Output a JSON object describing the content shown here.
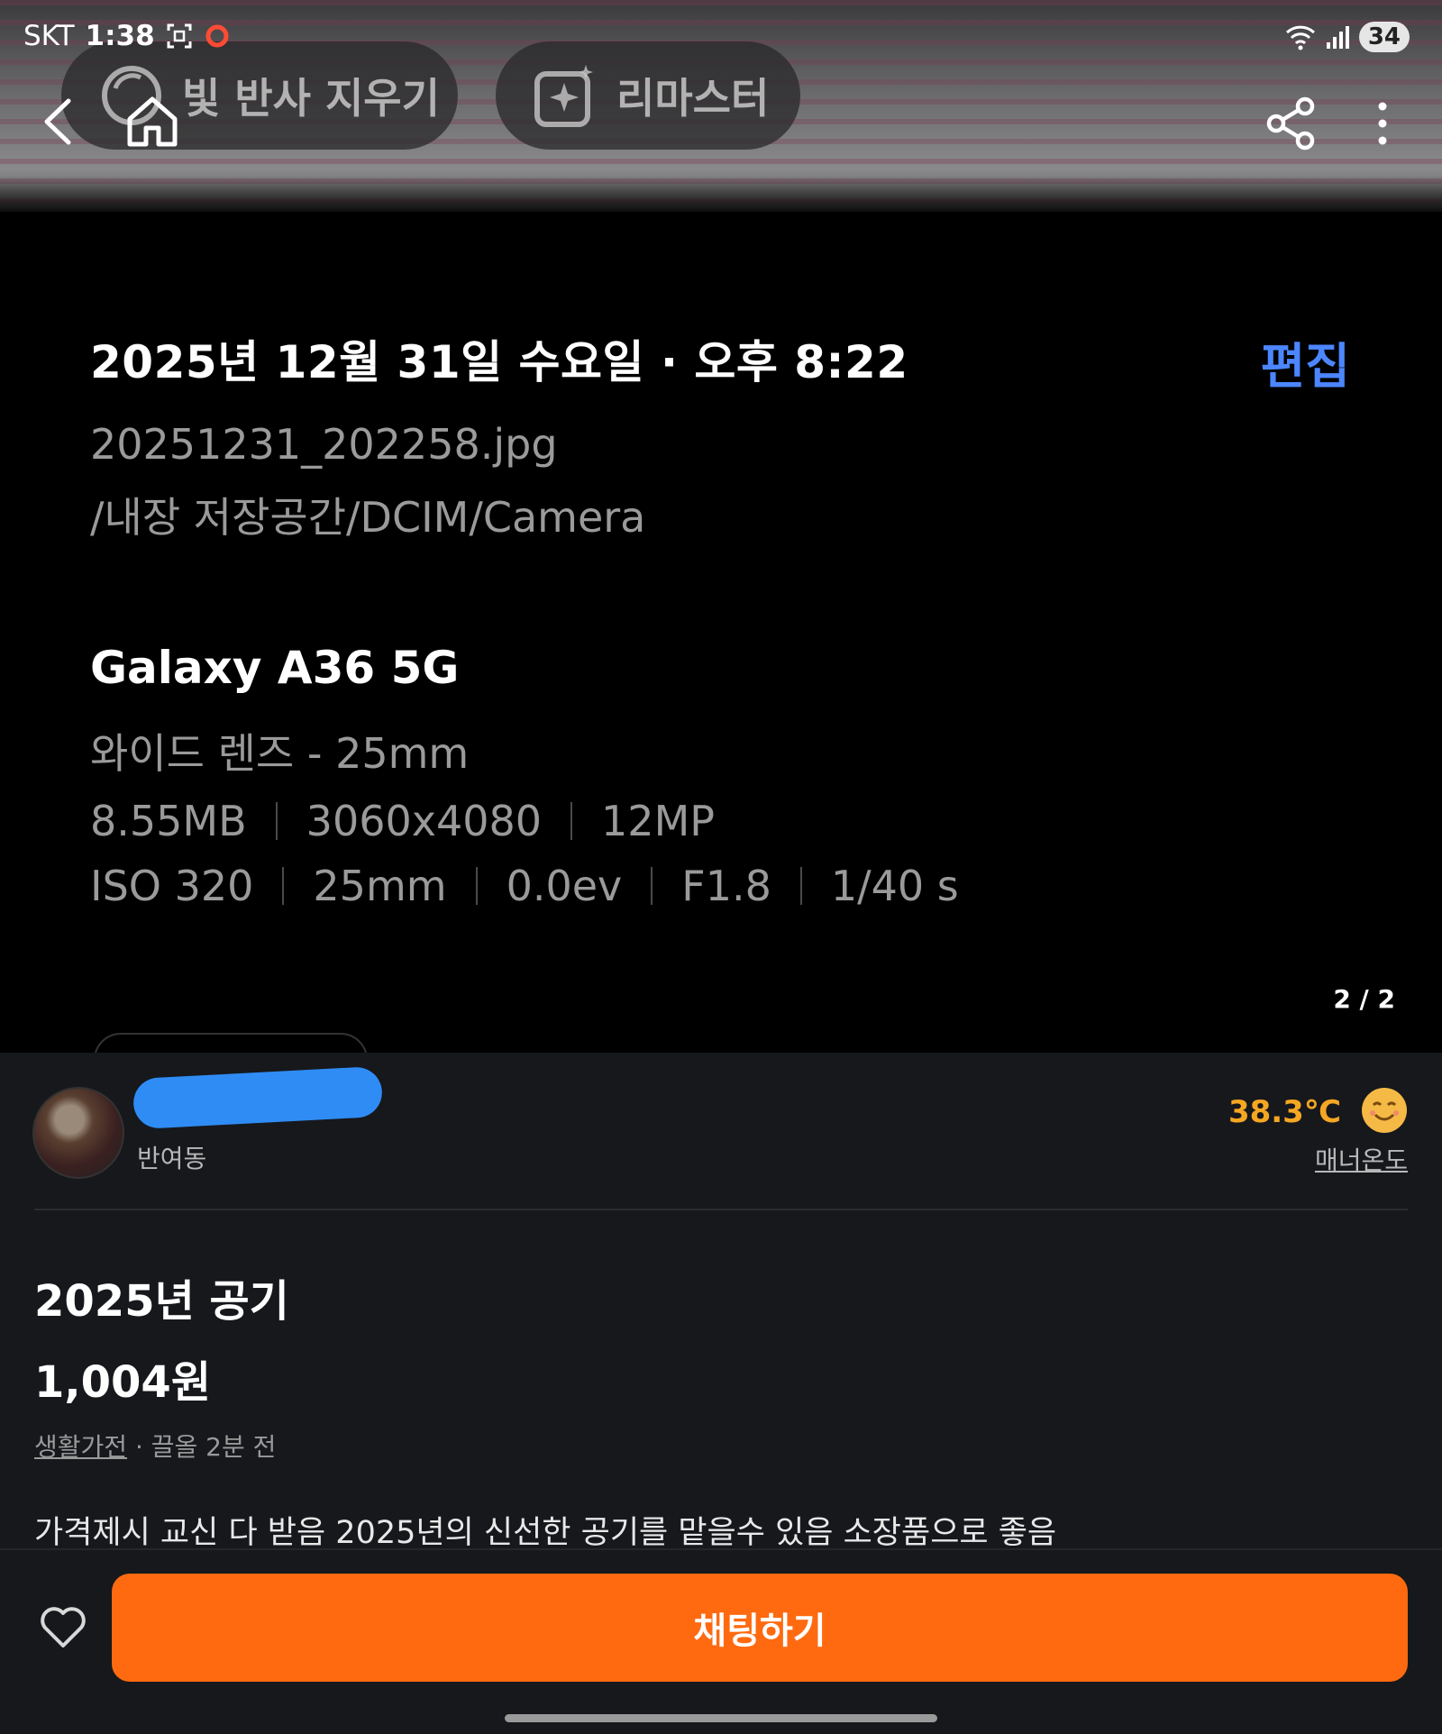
{
  "status_bar": {
    "carrier": "SKT",
    "time": "1:38",
    "battery": "34"
  },
  "photo_toolbar": {
    "reflect_label": "빛 반사 지우기",
    "remaster_label": "리마스터"
  },
  "photo_info": {
    "datetime": "2025년 12월 31일 수요일 · 오후 8:22",
    "edit_label": "편집",
    "filename": "20251231_202258.jpg",
    "path": "/내장 저장공간/DCIM/Camera",
    "device": "Galaxy A36 5G",
    "lens": "와이드 렌즈 - 25mm",
    "file_specs": [
      "8.55MB",
      "3060x4080",
      "12MP"
    ],
    "exposure_specs": [
      "ISO 320",
      "25mm",
      "0.0ev",
      "F1.8",
      "1/40 s"
    ]
  },
  "page_indicator": "2 / 2",
  "seller": {
    "location": "반여동",
    "temperature": "38.3℃",
    "manner_label": "매너온도"
  },
  "item": {
    "title": "2025년 공기",
    "price": "1,004원",
    "category": "생활가전",
    "meta_suffix": " · 끌올 2분 전",
    "description": "가격제시 교신 다 받음 2025년의 신선한 공기를 맡을수 있음 소장품으로 좋음"
  },
  "bottom": {
    "chat_label": "채팅하기"
  },
  "colors": {
    "accent": "#ff6a10",
    "temperature": "#f5a623",
    "edit": "#4c86ff"
  }
}
